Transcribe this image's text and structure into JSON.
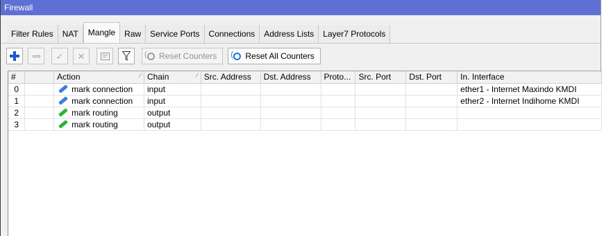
{
  "window": {
    "title": "Firewall"
  },
  "tabs": [
    {
      "label": "Filter Rules",
      "active": false
    },
    {
      "label": "NAT",
      "active": false
    },
    {
      "label": "Mangle",
      "active": true
    },
    {
      "label": "Raw",
      "active": false
    },
    {
      "label": "Service Ports",
      "active": false
    },
    {
      "label": "Connections",
      "active": false
    },
    {
      "label": "Address Lists",
      "active": false
    },
    {
      "label": "Layer7 Protocols",
      "active": false
    }
  ],
  "toolbar": {
    "add_icon": "plus-icon",
    "remove_icon": "minus-icon",
    "enable_icon": "check-icon",
    "disable_icon": "x-icon",
    "comment_icon": "comment-icon",
    "filter_icon": "filter-icon",
    "reset_counters": "Reset Counters",
    "reset_all_counters": "Reset All Counters"
  },
  "table": {
    "columns": [
      "#",
      "",
      "Action",
      "Chain",
      "Src. Address",
      "Dst. Address",
      "Proto...",
      "Src. Port",
      "Dst. Port",
      "In. Interface"
    ],
    "rows": [
      {
        "num": "0",
        "action": "mark connection",
        "chain": "input",
        "src_address": "",
        "dst_address": "",
        "proto": "",
        "src_port": "",
        "dst_port": "",
        "in_interface": "ether1 - Internet Maxindo KMDI",
        "icon_color": "#3a7fd8"
      },
      {
        "num": "1",
        "action": "mark connection",
        "chain": "input",
        "src_address": "",
        "dst_address": "",
        "proto": "",
        "src_port": "",
        "dst_port": "",
        "in_interface": "ether2 - Internet Indihome KMDI",
        "icon_color": "#3a7fd8"
      },
      {
        "num": "2",
        "action": "mark routing",
        "chain": "output",
        "src_address": "",
        "dst_address": "",
        "proto": "",
        "src_port": "",
        "dst_port": "",
        "in_interface": "",
        "icon_color": "#2fb335"
      },
      {
        "num": "3",
        "action": "mark routing",
        "chain": "output",
        "src_address": "",
        "dst_address": "",
        "proto": "",
        "src_port": "",
        "dst_port": "",
        "in_interface": "",
        "icon_color": "#2fb335"
      }
    ]
  }
}
